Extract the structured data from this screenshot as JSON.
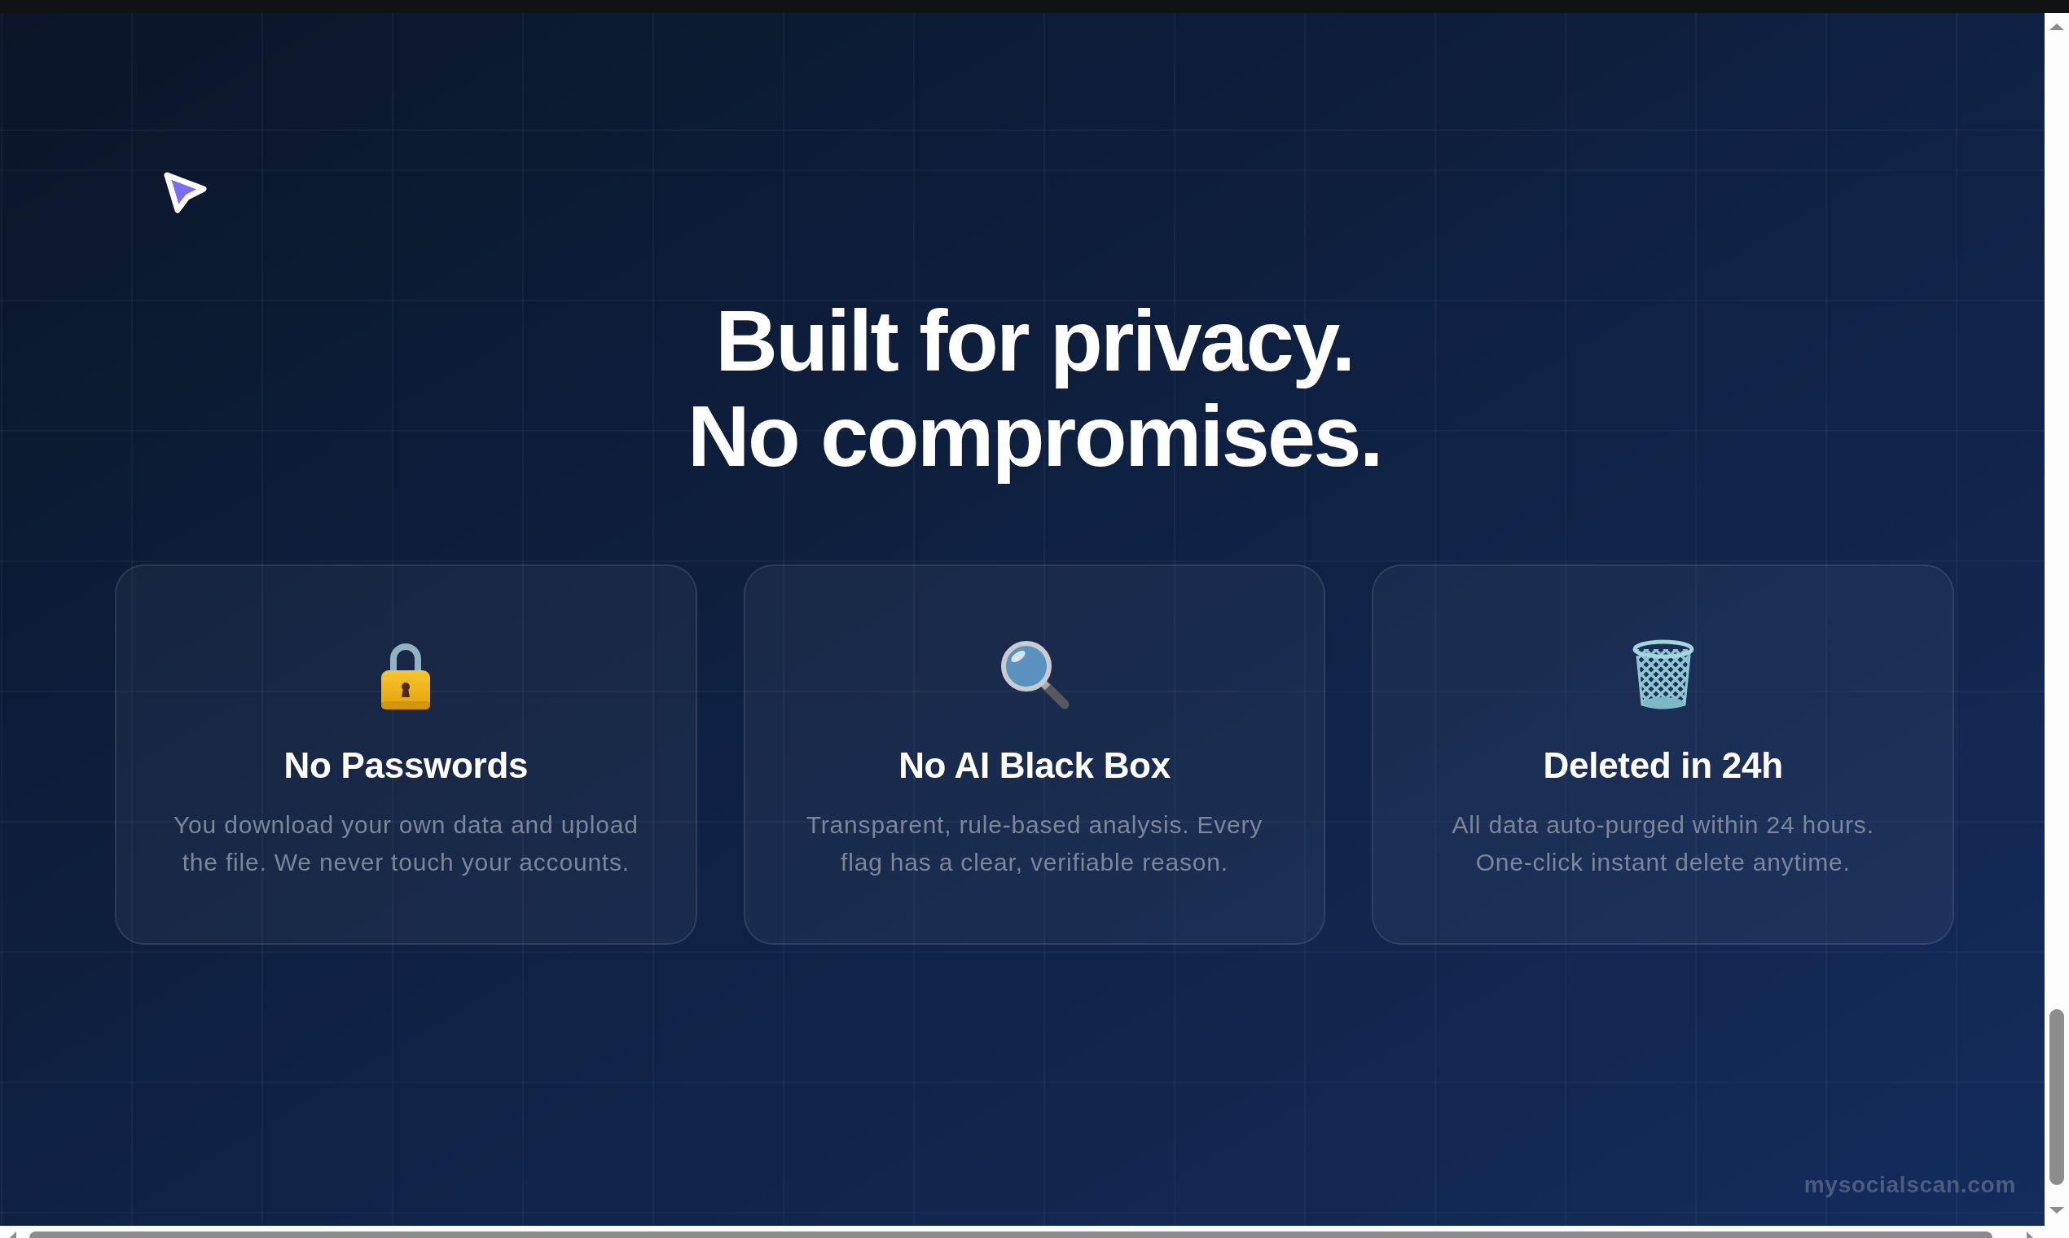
{
  "heading": {
    "lines": [
      "Built for privacy.",
      "No compromises."
    ]
  },
  "features": [
    {
      "title": "No Passwords",
      "description": "You download your own data and upload the file. We never touch your accounts."
    },
    {
      "title": "No AI Black Box",
      "description": "Transparent, rule-based analysis. Every flag has a clear, verifiable reason."
    },
    {
      "title": "Deleted in 24h",
      "description": "All data auto-purged within 24 hours. One-click instant delete anytime."
    }
  ],
  "site_url": "mysocialscan.com"
}
